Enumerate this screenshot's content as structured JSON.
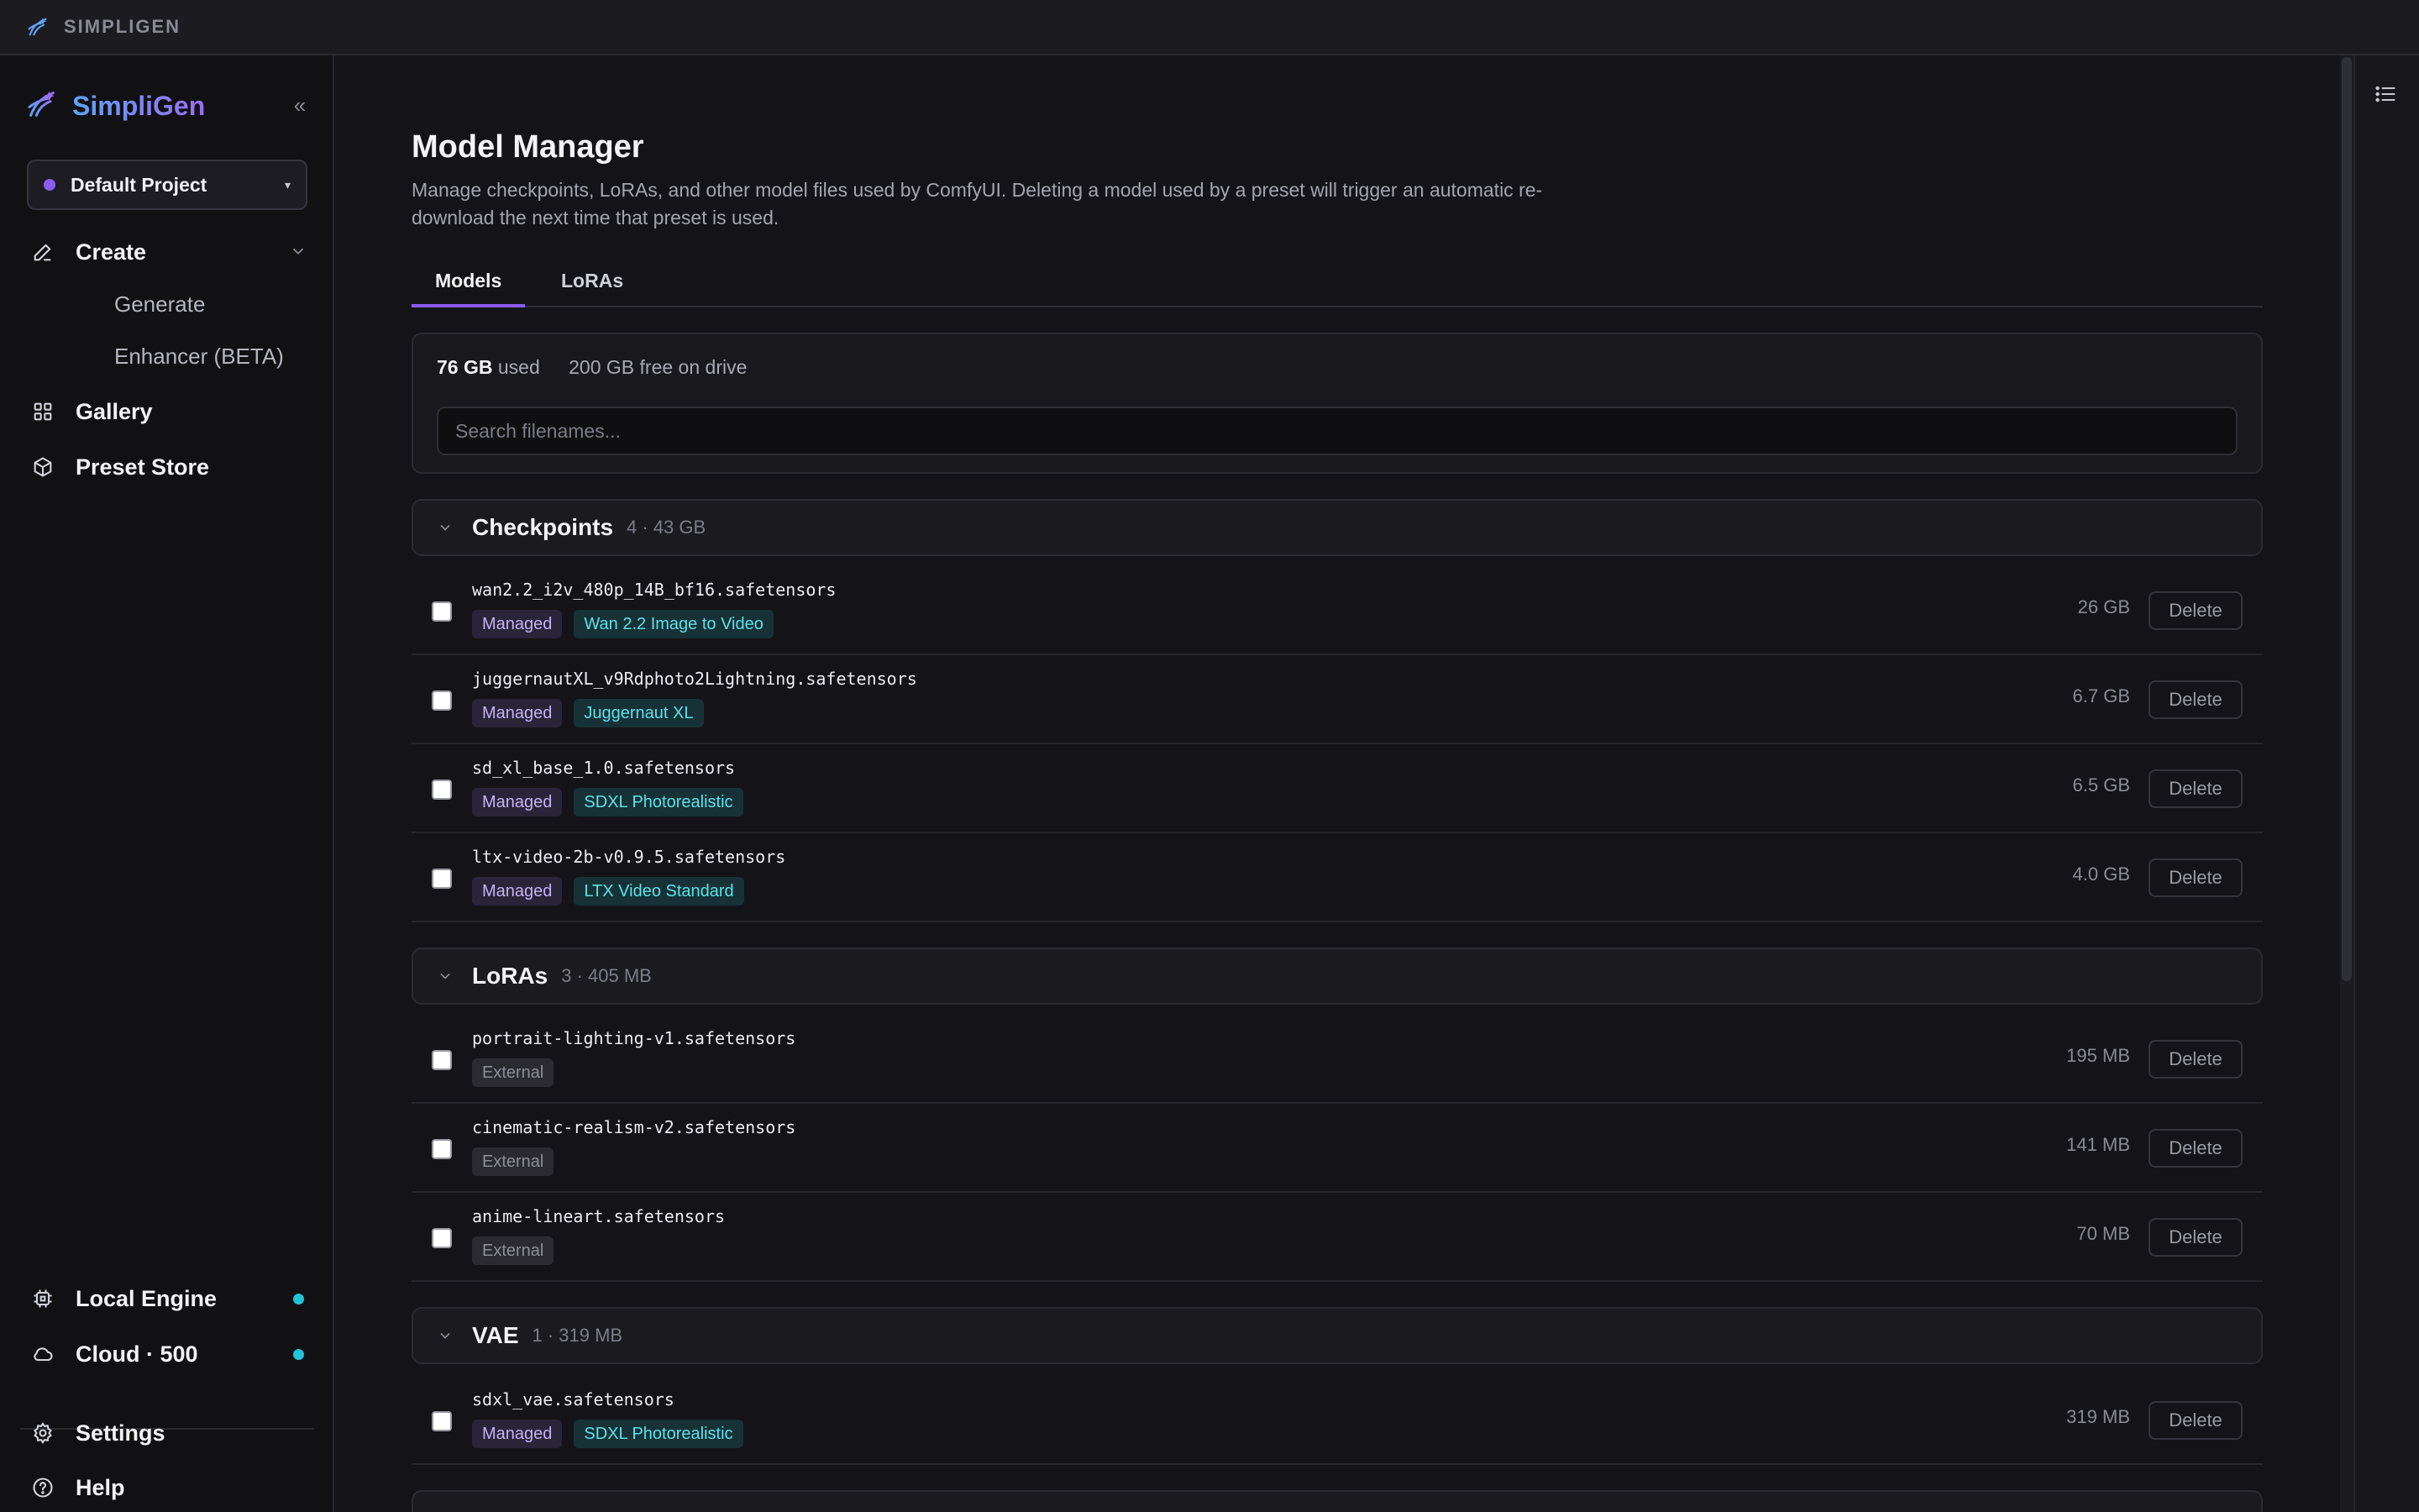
{
  "titlebar": {
    "app_name": "SIMPLIGEN"
  },
  "sidebar": {
    "brand": "SimpliGen",
    "collapse_glyph": "«",
    "project": {
      "label": "Default Project",
      "caret": "▾"
    },
    "nav": {
      "create": {
        "label": "Create",
        "icon": "pencil-icon"
      },
      "generate": {
        "label": "Generate"
      },
      "enhancer": {
        "label": "Enhancer (BETA)"
      },
      "gallery": {
        "label": "Gallery",
        "icon": "grid-icon"
      },
      "preset_store": {
        "label": "Preset Store",
        "icon": "box-icon"
      }
    },
    "bottom": {
      "local_engine": {
        "label": "Local Engine",
        "icon": "chip-icon"
      },
      "cloud": {
        "label": "Cloud · 500",
        "icon": "cloud-icon"
      },
      "settings": {
        "label": "Settings",
        "icon": "gear-icon"
      },
      "help": {
        "label": "Help",
        "icon": "help-icon"
      }
    }
  },
  "page": {
    "title": "Model Manager",
    "description": "Manage checkpoints, LoRAs, and other model files used by ComfyUI. Deleting a model used by a preset will trigger an automatic re-download the next time that preset is used.",
    "tabs": [
      {
        "label": "Models",
        "active": true
      },
      {
        "label": "LoRAs",
        "active": false
      }
    ],
    "usage": {
      "used_value": "76 GB",
      "used_suffix": "used",
      "free": "200 GB free on drive"
    },
    "search_placeholder": "Search filenames..."
  },
  "sections": {
    "checkpoints": {
      "title": "Checkpoints",
      "meta": "4 · 43 GB",
      "rows": [
        {
          "file": "wan2.2_i2v_480p_14B_bf16.safetensors",
          "tags": [
            "Managed",
            "Wan 2.2 Image to Video"
          ],
          "size": "26 GB"
        },
        {
          "file": "juggernautXL_v9Rdphoto2Lightning.safetensors",
          "tags": [
            "Managed",
            "Juggernaut XL"
          ],
          "size": "6.7 GB"
        },
        {
          "file": "sd_xl_base_1.0.safetensors",
          "tags": [
            "Managed",
            "SDXL Photorealistic"
          ],
          "size": "6.5 GB"
        },
        {
          "file": "ltx-video-2b-v0.9.5.safetensors",
          "tags": [
            "Managed",
            "LTX Video Standard"
          ],
          "size": "4.0 GB"
        }
      ]
    },
    "loras": {
      "title": "LoRAs",
      "meta": "3 · 405 MB",
      "rows": [
        {
          "file": "portrait-lighting-v1.safetensors",
          "tags": [
            "External"
          ],
          "size": "195 MB"
        },
        {
          "file": "cinematic-realism-v2.safetensors",
          "tags": [
            "External"
          ],
          "size": "141 MB"
        },
        {
          "file": "anime-lineart.safetensors",
          "tags": [
            "External"
          ],
          "size": "70 MB"
        }
      ]
    },
    "vae": {
      "title": "VAE",
      "meta": "1 · 319 MB",
      "rows": [
        {
          "file": "sdxl_vae.safetensors",
          "tags": [
            "Managed",
            "SDXL Photorealistic"
          ],
          "size": "319 MB"
        }
      ]
    }
  },
  "delete_label": "Delete",
  "colors": {
    "accent": "#8b5cf6",
    "status_online": "#22c3d6",
    "preset_tag": "#5fe0ea",
    "managed_tag": "#c4b2f4"
  }
}
